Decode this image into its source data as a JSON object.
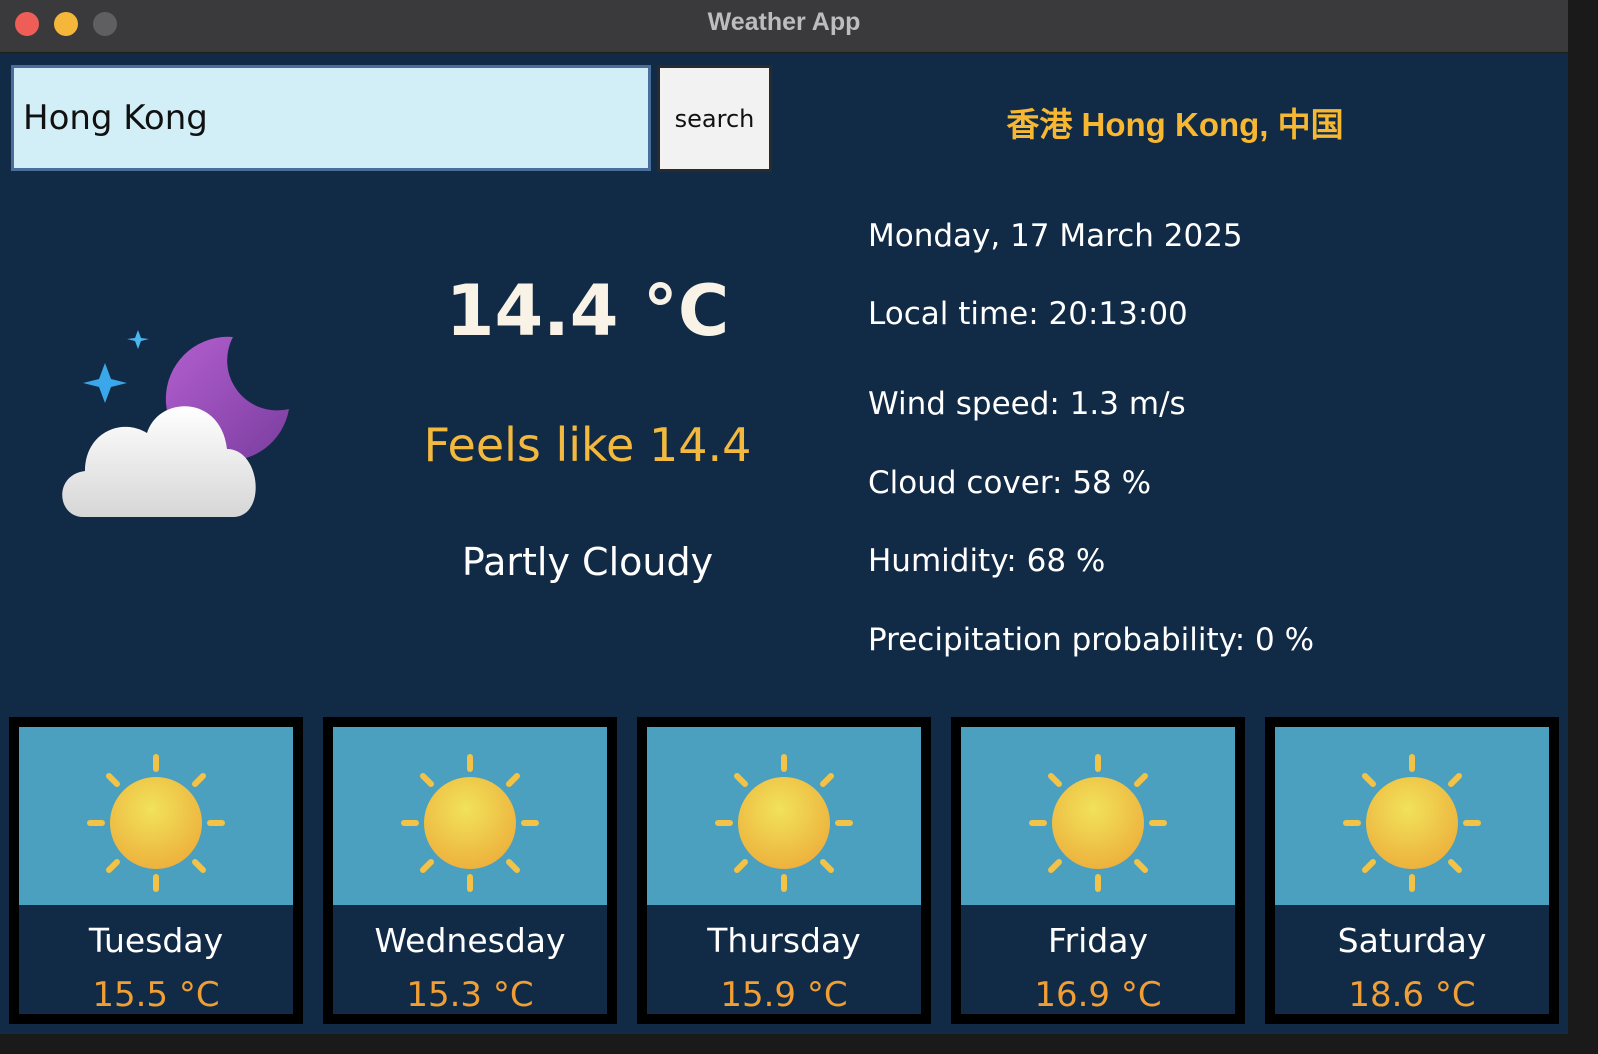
{
  "window": {
    "title": "Weather App"
  },
  "search": {
    "value": "Hong Kong",
    "button_label": "search"
  },
  "location": "香港 Hong Kong, 中国",
  "current": {
    "icon": "partly-cloudy-night-icon",
    "temperature": "14.4 °C",
    "feels_like": "Feels like 14.4",
    "condition": "Partly Cloudy"
  },
  "details": {
    "date": "Monday, 17 March 2025",
    "local_time": "Local time: 20:13:00",
    "wind_speed": "Wind speed: 1.3 m/s",
    "cloud_cover": "Cloud cover: 58 %",
    "humidity": "Humidity: 68 %",
    "precipitation": "Precipitation probability: 0 %"
  },
  "forecast": [
    {
      "day": "Tuesday",
      "temp": "15.5 °C",
      "icon": "sun-icon"
    },
    {
      "day": "Wednesday",
      "temp": "15.3 °C",
      "icon": "sun-icon"
    },
    {
      "day": "Thursday",
      "temp": "15.9 °C",
      "icon": "sun-icon"
    },
    {
      "day": "Friday",
      "temp": "16.9 °C",
      "icon": "sun-icon"
    },
    {
      "day": "Saturday",
      "temp": "18.6 °C",
      "icon": "sun-icon"
    }
  ],
  "colors": {
    "background": "#112a45",
    "accent_location": "#f7b731",
    "accent_feels": "#f3b93e",
    "forecast_temp": "#ef9f35",
    "card_sky": "#4b9fbf",
    "input_bg": "#d2eff7"
  }
}
